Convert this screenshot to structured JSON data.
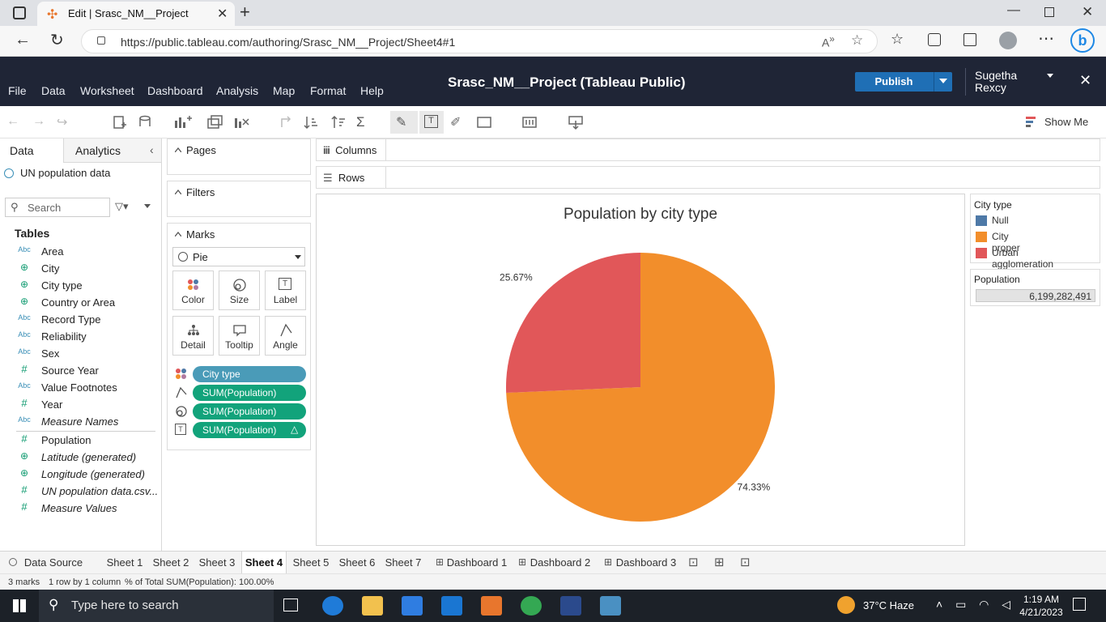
{
  "browser": {
    "tab_title": "Edit | Srasc_NM__Project",
    "url": "https://public.tableau.com/authoring/Srasc_NM__Project/Sheet4#1"
  },
  "tableau": {
    "menu": [
      "File",
      "Data",
      "Worksheet",
      "Dashboard",
      "Analysis",
      "Map",
      "Format",
      "Help"
    ],
    "workbook_title": "Srasc_NM__Project (Tableau Public)",
    "publish_label": "Publish",
    "user_name": "Sugetha Rexcy",
    "show_me_label": "Show Me"
  },
  "data_pane": {
    "tab_data": "Data",
    "tab_analytics": "Analytics",
    "datasource": "UN population data",
    "search_placeholder": "Search",
    "tables_heading": "Tables",
    "dimensions": [
      {
        "type": "Abc",
        "name": "Area"
      },
      {
        "type": "geo",
        "name": "City"
      },
      {
        "type": "geo",
        "name": "City type"
      },
      {
        "type": "geo",
        "name": "Country or Area"
      },
      {
        "type": "Abc",
        "name": "Record Type"
      },
      {
        "type": "Abc",
        "name": "Reliability"
      },
      {
        "type": "Abc",
        "name": "Sex"
      },
      {
        "type": "#",
        "name": "Source Year"
      },
      {
        "type": "Abc",
        "name": "Value Footnotes"
      },
      {
        "type": "#",
        "name": "Year"
      },
      {
        "type": "Abc",
        "name": "Measure Names"
      }
    ],
    "measures": [
      {
        "type": "#",
        "name": "Population"
      },
      {
        "type": "geo",
        "name": "Latitude (generated)"
      },
      {
        "type": "geo",
        "name": "Longitude (generated)"
      },
      {
        "type": "#",
        "name": "UN population data.csv..."
      },
      {
        "type": "#",
        "name": "Measure Values"
      }
    ]
  },
  "cards": {
    "pages_title": "Pages",
    "filters_title": "Filters",
    "marks_title": "Marks",
    "mark_type": "Pie",
    "mark_buttons": [
      "Color",
      "Size",
      "Label",
      "Detail",
      "Tooltip",
      "Angle"
    ],
    "pills": [
      {
        "label": "City type",
        "color": "#4a9bb8"
      },
      {
        "label": "SUM(Population)",
        "color": "#12a37b"
      },
      {
        "label": "SUM(Population)",
        "color": "#12a37b"
      },
      {
        "label": "SUM(Population)",
        "color": "#12a37b"
      }
    ]
  },
  "shelves": {
    "columns_label": "Columns",
    "rows_label": "Rows"
  },
  "chart_data": {
    "type": "pie",
    "title": "Population by city type",
    "slices": [
      {
        "label": "City proper",
        "value": 74.33,
        "display": "74.33%",
        "color": "#f28e2b"
      },
      {
        "label": "Urban agglomeration",
        "value": 25.67,
        "display": "25.67%",
        "color": "#e15759"
      }
    ]
  },
  "legend": {
    "title": "City type",
    "items": [
      {
        "label": "Null",
        "color": "#4e79a7"
      },
      {
        "label": "City proper",
        "color": "#f28e2b"
      },
      {
        "label": "Urban agglomeration",
        "color": "#e15759"
      }
    ]
  },
  "size_legend": {
    "title": "Population",
    "value": "6,199,282,491"
  },
  "sheet_tabs": [
    "Data Source",
    "Sheet 1",
    "Sheet 2",
    "Sheet 3",
    "Sheet 4",
    "Sheet 5",
    "Sheet 6",
    "Sheet 7",
    "Dashboard 1",
    "Dashboard 2",
    "Dashboard 3"
  ],
  "active_sheet": "Sheet 4",
  "status": {
    "marks": "3 marks",
    "dims": "1 row by 1 column",
    "summary": "% of Total SUM(Population): 100.00%"
  },
  "taskbar": {
    "search_placeholder": "Type here to search",
    "weather": "37°C  Haze",
    "time": "1:19 AM",
    "date": "4/21/2023"
  }
}
